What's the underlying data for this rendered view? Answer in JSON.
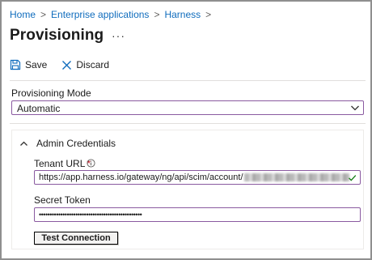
{
  "breadcrumb": {
    "items": [
      "Home",
      "Enterprise applications",
      "Harness"
    ],
    "separator": ">"
  },
  "page": {
    "title": "Provisioning",
    "more": "···"
  },
  "toolbar": {
    "save_label": "Save",
    "discard_label": "Discard"
  },
  "provisioning_mode": {
    "label": "Provisioning Mode",
    "value": "Automatic"
  },
  "admin_credentials": {
    "section_label": "Admin Credentials",
    "tenant_url": {
      "label": "Tenant URL",
      "required_mark": "*",
      "value": "https://app.harness.io/gateway/ng/api/scim/account/"
    },
    "secret_token": {
      "label": "Secret Token",
      "value": "••••••••••••••••••••••••••••••••••••••••••••••••"
    },
    "test_button_label": "Test Connection"
  },
  "colors": {
    "link": "#0f6cbd",
    "focus_border": "#8a5aa0",
    "required": "#c50f1f",
    "valid_check": "#107c10"
  },
  "icons": {
    "save": "save-icon",
    "discard": "close-icon",
    "select": "chevron-down-icon",
    "section": "chevron-up-icon",
    "info": "info-icon",
    "valid": "check-icon"
  }
}
